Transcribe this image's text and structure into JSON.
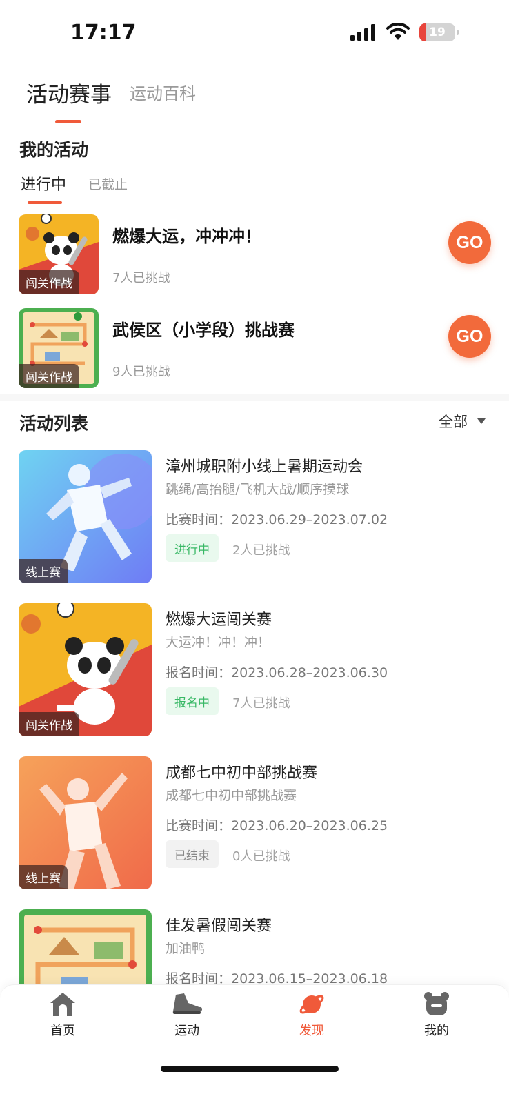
{
  "status_bar": {
    "time": "17:17",
    "battery": "19"
  },
  "top_tabs": {
    "active": "活动赛事",
    "other": "运动百科"
  },
  "my_activities": {
    "title": "我的活动",
    "tab_active": "进行中",
    "tab_other": "已截止",
    "items": [
      {
        "title": "燃爆大运，冲冲冲！",
        "count": "7人已挑战",
        "tag": "闯关作战",
        "action": "GO"
      },
      {
        "title": "武侯区（小学段）挑战赛",
        "count": "9人已挑战",
        "tag": "闯关作战",
        "action": "GO"
      }
    ]
  },
  "activity_list": {
    "title": "活动列表",
    "filter": "全部",
    "items": [
      {
        "title": "漳州城职附小线上暑期运动会",
        "subtitle": "跳绳/高抬腿/飞机大战/顺序摸球",
        "time": "比赛时间：2023.06.29–2023.07.02",
        "status": "进行中",
        "count": "2人已挑战",
        "tag": "线上赛"
      },
      {
        "title": "燃爆大运闯关赛",
        "subtitle": "大运冲！冲！冲！",
        "time": "报名时间：2023.06.28–2023.06.30",
        "status": "报名中",
        "count": "7人已挑战",
        "tag": "闯关作战"
      },
      {
        "title": "成都七中初中部挑战赛",
        "subtitle": "成都七中初中部挑战赛",
        "time": "比赛时间：2023.06.20–2023.06.25",
        "status": "已结束",
        "count": "0人已挑战",
        "tag": "线上赛"
      },
      {
        "title": "佳发暑假闯关赛",
        "subtitle": "加油鸭",
        "time": "报名时间：2023.06.15–2023.06.18"
      }
    ]
  },
  "bottom_nav": [
    {
      "label": "首页",
      "icon": "home-icon"
    },
    {
      "label": "运动",
      "icon": "sneaker-icon"
    },
    {
      "label": "发现",
      "icon": "planet-icon"
    },
    {
      "label": "我的",
      "icon": "bear-icon"
    }
  ],
  "colors": {
    "accent": "#f05a3a",
    "go": "#f26a3b",
    "green": "#38b865"
  }
}
